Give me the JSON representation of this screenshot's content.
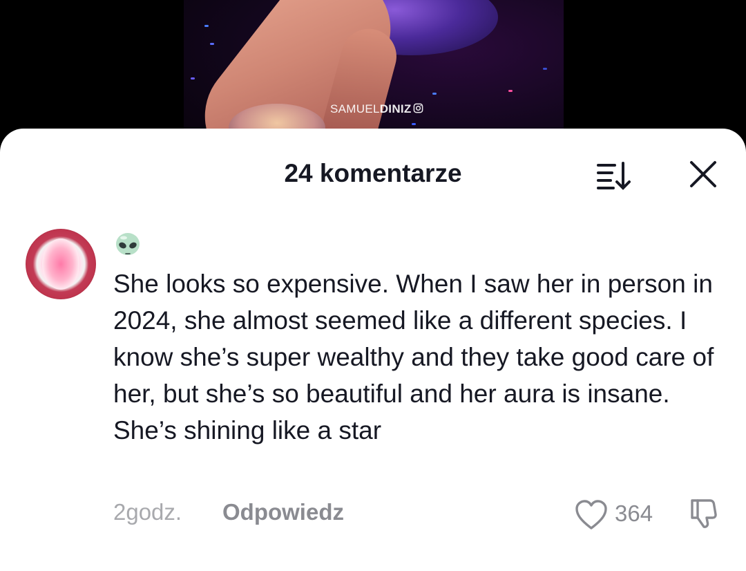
{
  "video": {
    "watermark_prefix": "SAMUEL",
    "watermark_bold": "DINIZ",
    "watermark_icon": "instagram-icon"
  },
  "sheet": {
    "title": "24 komentarze",
    "sort_icon": "sort-icon",
    "close_icon": "close-icon"
  },
  "comment": {
    "username_icon": "alien-emoji",
    "text": "She looks so expensive. When I saw her in person in 2024, she almost seemed like a different species. I know she’s super wealthy and they take good care of her, but she’s so beautiful and her aura is insane. She’s shining like a star",
    "time": "2godz.",
    "reply_label": "Odpowiedz",
    "like_count": "364",
    "like_icon": "heart-outline-icon",
    "dislike_icon": "thumbs-down-icon"
  },
  "colors": {
    "text_primary": "#161823",
    "text_secondary": "#8a8b91",
    "text_tertiary": "#a8a9ad",
    "sheet_bg": "#ffffff"
  }
}
